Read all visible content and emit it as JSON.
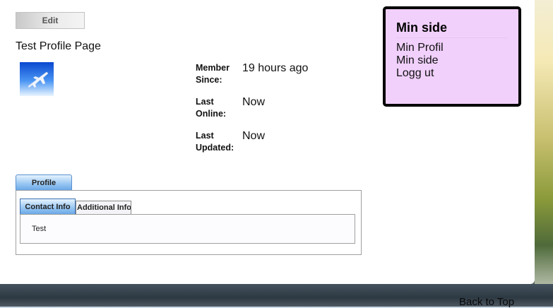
{
  "toolbar": {
    "edit_label": "Edit"
  },
  "page": {
    "title": "Test Profile Page"
  },
  "profile_info": {
    "member_since": {
      "label": "Member Since:",
      "value": "19 hours ago"
    },
    "last_online": {
      "label": "Last Online:",
      "value": "Now"
    },
    "last_updated": {
      "label": "Last Updated:",
      "value": "Now"
    }
  },
  "tabs": {
    "main": [
      {
        "label": "Profile"
      }
    ],
    "sub": [
      {
        "label": "Contact Info"
      },
      {
        "label": "Additional Info"
      }
    ]
  },
  "tab_content": {
    "text": "Test"
  },
  "sidebar": {
    "title": "Min side",
    "links": [
      {
        "label": "Min Profil"
      },
      {
        "label": "Min side"
      },
      {
        "label": "Logg ut"
      }
    ]
  },
  "footer": {
    "back_to_top": "Back to Top"
  },
  "colors": {
    "sidebar_bg": "#f1d0fb",
    "tab_active": "#9cc9f3"
  },
  "icons": {
    "avatar": "airplane-icon"
  }
}
